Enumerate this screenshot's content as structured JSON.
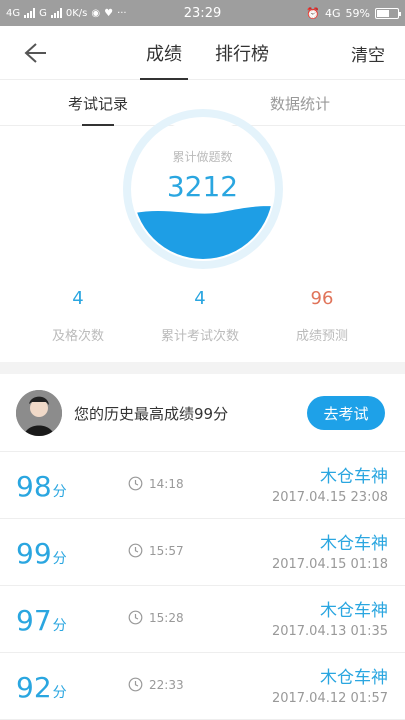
{
  "status_bar": {
    "net1": "4G",
    "net2": "G",
    "speed": "0K/s",
    "time": "23:29",
    "net3": "4G",
    "battery": "59%",
    "battery_level": 0.59
  },
  "navbar": {
    "tab_score": "成绩",
    "tab_rank": "排行榜",
    "clear": "清空"
  },
  "subtabs": {
    "records": "考试记录",
    "stats": "数据统计"
  },
  "gauge": {
    "label": "累计做题数",
    "value": "3212"
  },
  "stats": {
    "pass_count": "4",
    "pass_label": "及格次数",
    "exam_count": "4",
    "exam_label": "累计考试次数",
    "prediction": "96",
    "prediction_label": "成绩预测"
  },
  "best": {
    "text": "您的历史最高成绩99分",
    "button": "去考试"
  },
  "score_unit": "分",
  "records": [
    {
      "score": "98",
      "duration": "14:18",
      "name": "木仓车神",
      "date": "2017.04.15  23:08"
    },
    {
      "score": "99",
      "duration": "15:57",
      "name": "木仓车神",
      "date": "2017.04.15  01:18"
    },
    {
      "score": "97",
      "duration": "15:28",
      "name": "木仓车神",
      "date": "2017.04.13  01:35"
    },
    {
      "score": "92",
      "duration": "22:33",
      "name": "木仓车神",
      "date": "2017.04.12  01:57"
    }
  ],
  "colors": {
    "accent": "#2aa6e0",
    "button": "#1ea1e8",
    "prediction": "#e0745a"
  }
}
